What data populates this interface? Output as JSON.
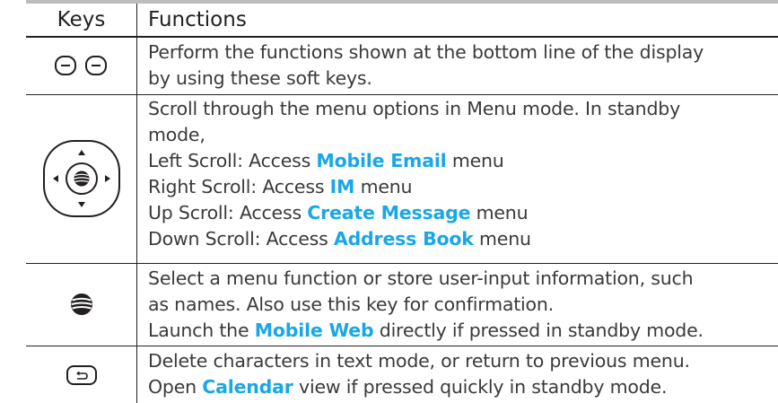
{
  "table": {
    "headers": {
      "keys": "Keys",
      "functions": "Functions"
    },
    "rows": [
      {
        "key_icon": "soft-keys-icon",
        "lines": [
          {
            "parts": [
              "Perform the functions shown at the bottom line of the display"
            ]
          },
          {
            "parts": [
              "by using these soft keys."
            ]
          }
        ]
      },
      {
        "key_icon": "navigation-key-icon",
        "lines": [
          {
            "parts": [
              "Scroll through the menu options in Menu mode. In standby"
            ]
          },
          {
            "parts": [
              "mode,"
            ]
          },
          {
            "parts": [
              "Left Scroll: Access ",
              "Mobile Email",
              " menu"
            ]
          },
          {
            "parts": [
              "Right Scroll: Access ",
              "IM",
              " menu"
            ]
          },
          {
            "parts": [
              "Up Scroll: Access ",
              "Create Message",
              " menu"
            ]
          },
          {
            "parts": [
              "Down Scroll: Access ",
              "Address Book",
              " menu"
            ]
          }
        ]
      },
      {
        "key_icon": "att-globe-key-icon",
        "lines": [
          {
            "parts": [
              "Select a menu function or store user-input information, such"
            ]
          },
          {
            "parts": [
              "as names. Also use this key for confirmation."
            ]
          },
          {
            "parts": [
              "Launch the ",
              "Mobile Web",
              " directly if pressed in standby mode."
            ]
          }
        ]
      },
      {
        "key_icon": "back-key-icon",
        "lines": [
          {
            "parts": [
              "Delete characters in text mode, or return to previous menu."
            ]
          },
          {
            "parts": [
              "Open ",
              "Calendar",
              " view if pressed quickly in standby mode."
            ]
          }
        ]
      }
    ]
  },
  "colors": {
    "text": "#3a3a3a",
    "highlight": "#19a7e6",
    "rule": "#231f20"
  }
}
